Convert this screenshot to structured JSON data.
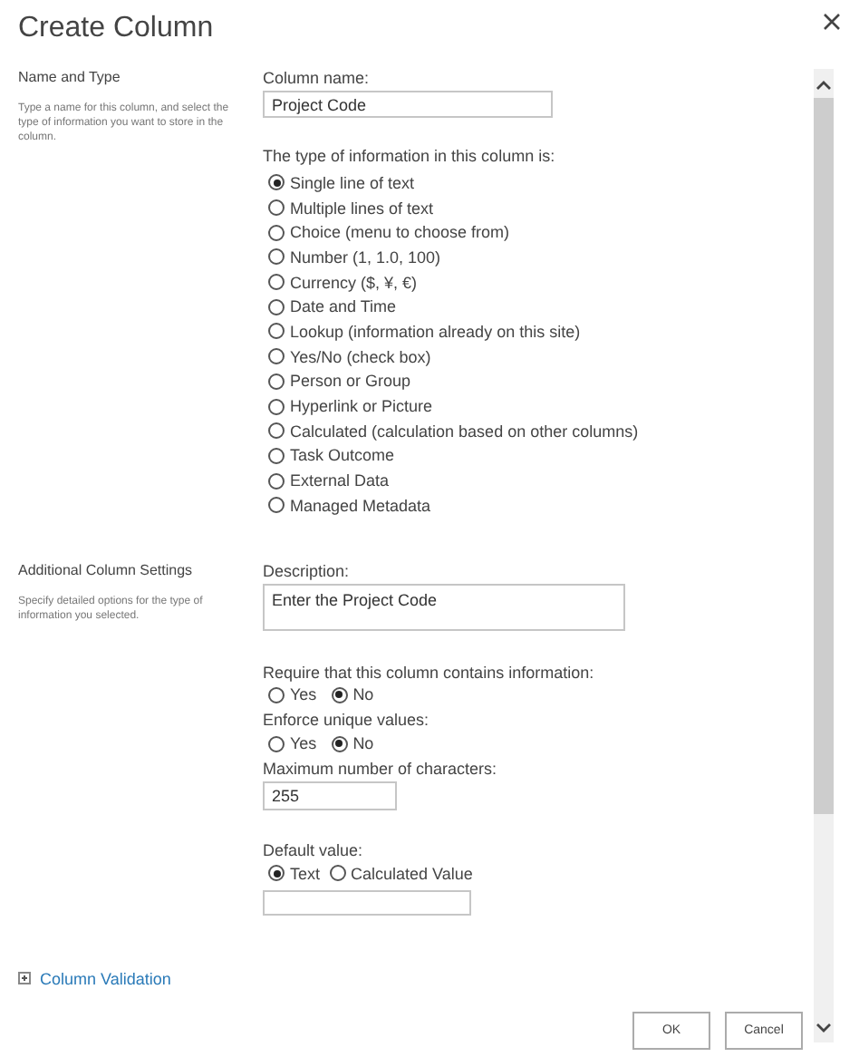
{
  "dialog": {
    "title": "Create Column"
  },
  "name_and_type": {
    "heading": "Name and Type",
    "description": "Type a name for this column, and select the type of information you want to store in the column.",
    "column_name_label": "Column name:",
    "column_name_value": "Project Code",
    "type_label": "The type of information in this column is:",
    "types": [
      {
        "label": "Single line of text",
        "selected": true
      },
      {
        "label": "Multiple lines of text",
        "selected": false
      },
      {
        "label": "Choice (menu to choose from)",
        "selected": false
      },
      {
        "label": "Number (1, 1.0, 100)",
        "selected": false
      },
      {
        "label": "Currency ($, ¥, €)",
        "selected": false
      },
      {
        "label": "Date and Time",
        "selected": false
      },
      {
        "label": "Lookup (information already on this site)",
        "selected": false
      },
      {
        "label": "Yes/No (check box)",
        "selected": false
      },
      {
        "label": "Person or Group",
        "selected": false
      },
      {
        "label": "Hyperlink or Picture",
        "selected": false
      },
      {
        "label": "Calculated (calculation based on other columns)",
        "selected": false
      },
      {
        "label": "Task Outcome",
        "selected": false
      },
      {
        "label": "External Data",
        "selected": false
      },
      {
        "label": "Managed Metadata",
        "selected": false
      }
    ]
  },
  "additional_settings": {
    "heading": "Additional Column Settings",
    "description": "Specify detailed options for the type of information you selected.",
    "description_label": "Description:",
    "description_value": "Enter the Project Code",
    "require_label": "Require that this column contains information:",
    "require_options": [
      {
        "label": "Yes",
        "selected": false
      },
      {
        "label": "No",
        "selected": true
      }
    ],
    "unique_label": "Enforce unique values:",
    "unique_options": [
      {
        "label": "Yes",
        "selected": false
      },
      {
        "label": "No",
        "selected": true
      }
    ],
    "max_chars_label": "Maximum number of characters:",
    "max_chars_value": "255",
    "default_label": "Default value:",
    "default_options": [
      {
        "label": "Text",
        "selected": true
      },
      {
        "label": "Calculated Value",
        "selected": false
      }
    ]
  },
  "column_validation": "Column Validation",
  "buttons": [
    "OK",
    "Cancel"
  ]
}
